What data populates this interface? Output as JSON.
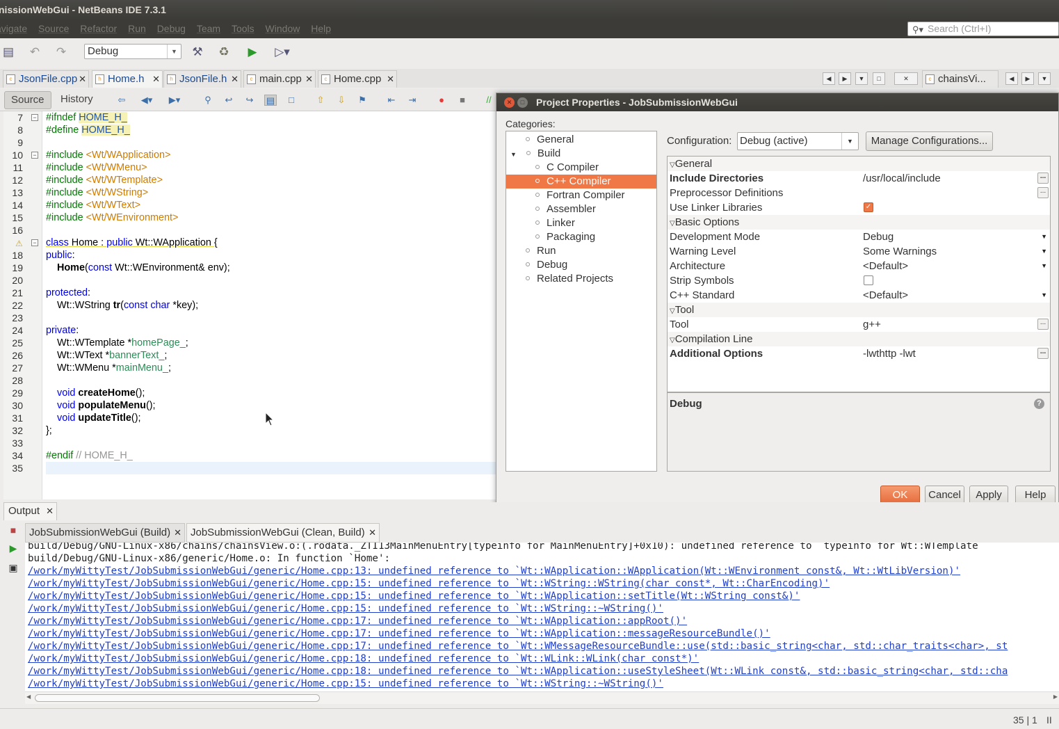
{
  "window": {
    "title": "nissionWebGui - NetBeans IDE 7.3.1"
  },
  "menu": [
    "avigate",
    "Source",
    "Refactor",
    "Run",
    "Debug",
    "Team",
    "Tools",
    "Window",
    "Help"
  ],
  "search": {
    "placeholder": "Search (Ctrl+I)"
  },
  "toolbar": {
    "config_value": "Debug"
  },
  "editor_tabs": [
    {
      "label": "JsonFile.cpp"
    },
    {
      "label": "Home.h"
    },
    {
      "label": "JsonFile.h"
    },
    {
      "label": "main.cpp"
    },
    {
      "label": "Home.cpp"
    }
  ],
  "side_tab": {
    "label": "chainsVi..."
  },
  "editor_toolbar": {
    "source": "Source",
    "history": "History"
  },
  "editor": {
    "line_numbers": [
      "7",
      "8",
      "9",
      "10",
      "11",
      "12",
      "13",
      "14",
      "15",
      "16",
      "",
      "18",
      "19",
      "20",
      "21",
      "22",
      "23",
      "24",
      "25",
      "26",
      "27",
      "28",
      "29",
      "30",
      "31",
      "32",
      "33",
      "34",
      "35"
    ]
  },
  "dialog": {
    "title": "Project Properties - JobSubmissionWebGui",
    "categories_label": "Categories:",
    "categories": [
      {
        "label": "General"
      },
      {
        "label": "Build"
      },
      {
        "label": "C Compiler"
      },
      {
        "label": "C++ Compiler"
      },
      {
        "label": "Fortran Compiler"
      },
      {
        "label": "Assembler"
      },
      {
        "label": "Linker"
      },
      {
        "label": "Packaging"
      },
      {
        "label": "Run"
      },
      {
        "label": "Debug"
      },
      {
        "label": "Related Projects"
      }
    ],
    "configuration_label": "Configuration:",
    "configuration_value": "Debug (active)",
    "manage_button": "Manage Configurations...",
    "sections": {
      "general": "General",
      "basic": "Basic Options",
      "tool": "Tool",
      "compilation": "Compilation Line"
    },
    "props": {
      "include_dirs": {
        "name": "Include Directories",
        "value": "/usr/local/include"
      },
      "preproc": {
        "name": "Preprocessor Definitions",
        "value": ""
      },
      "linker_libs": {
        "name": "Use Linker Libraries",
        "checked": true
      },
      "dev_mode": {
        "name": "Development Mode",
        "value": "Debug"
      },
      "warning": {
        "name": "Warning Level",
        "value": "Some Warnings"
      },
      "arch": {
        "name": "Architecture",
        "value": "<Default>"
      },
      "strip": {
        "name": "Strip Symbols",
        "checked": false
      },
      "std": {
        "name": "C++ Standard",
        "value": "<Default>"
      },
      "tool": {
        "name": "Tool",
        "value": "g++"
      },
      "additional": {
        "name": "Additional Options",
        "value": "-lwthttp -lwt"
      }
    },
    "description_title": "Debug",
    "buttons": {
      "ok": "OK",
      "cancel": "Cancel",
      "apply": "Apply",
      "help": "Help"
    }
  },
  "output": {
    "title": "Output",
    "tabs": [
      "JobSubmissionWebGui (Build)",
      "JobSubmissionWebGui (Clean, Build)"
    ],
    "lines": [
      {
        "text": "build/Debug/GNU-Linux-x86/chains/chainsView.o:(.rodata._ZTI13MainMenuEntry[typeinfo for MainMenuEntry]+0x10): undefined reference to `typeinfo for Wt::WTemplate",
        "link": false
      },
      {
        "text": "build/Debug/GNU-Linux-x86/generic/Home.o: In function `Home':",
        "link": false
      },
      {
        "text": "/work/myWittyTest/JobSubmissionWebGui/generic/Home.cpp:13: undefined reference to `Wt::WApplication::WApplication(Wt::WEnvironment const&, Wt::WtLibVersion)'",
        "link": true
      },
      {
        "text": "/work/myWittyTest/JobSubmissionWebGui/generic/Home.cpp:15: undefined reference to `Wt::WString::WString(char const*, Wt::CharEncoding)'",
        "link": true
      },
      {
        "text": "/work/myWittyTest/JobSubmissionWebGui/generic/Home.cpp:15: undefined reference to `Wt::WApplication::setTitle(Wt::WString const&)'",
        "link": true
      },
      {
        "text": "/work/myWittyTest/JobSubmissionWebGui/generic/Home.cpp:15: undefined reference to `Wt::WString::~WString()'",
        "link": true
      },
      {
        "text": "/work/myWittyTest/JobSubmissionWebGui/generic/Home.cpp:17: undefined reference to `Wt::WApplication::appRoot()'",
        "link": true
      },
      {
        "text": "/work/myWittyTest/JobSubmissionWebGui/generic/Home.cpp:17: undefined reference to `Wt::WApplication::messageResourceBundle()'",
        "link": true
      },
      {
        "text": "/work/myWittyTest/JobSubmissionWebGui/generic/Home.cpp:17: undefined reference to `Wt::WMessageResourceBundle::use(std::basic_string<char, std::char_traits<char>, st",
        "link": true
      },
      {
        "text": "/work/myWittyTest/JobSubmissionWebGui/generic/Home.cpp:18: undefined reference to `Wt::WLink::WLink(char const*)'",
        "link": true
      },
      {
        "text": "/work/myWittyTest/JobSubmissionWebGui/generic/Home.cpp:18: undefined reference to `Wt::WApplication::useStyleSheet(Wt::WLink const&, std::basic_string<char, std::cha",
        "link": true
      },
      {
        "text": "/work/myWittyTest/JobSubmissionWebGui/generic/Home.cpp:15: undefined reference to `Wt::WString::~WString()'",
        "link": true
      }
    ]
  },
  "status": {
    "caret": "35 | 1",
    "mode": "II"
  },
  "colors": {
    "accent": "#f07746",
    "titlebar": "#3c3b37",
    "link": "#1f3ec9"
  }
}
